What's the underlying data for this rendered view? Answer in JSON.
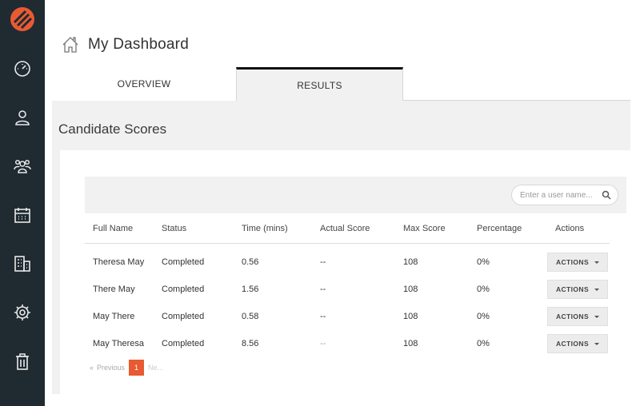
{
  "sidebar": {
    "logo": "brand-logo",
    "items": [
      {
        "icon": "speedometer-icon"
      },
      {
        "icon": "user-icon"
      },
      {
        "icon": "users-icon"
      },
      {
        "icon": "calendar-icon"
      },
      {
        "icon": "building-icon"
      },
      {
        "icon": "gear-icon"
      },
      {
        "icon": "trash-icon"
      }
    ]
  },
  "header": {
    "title": "My Dashboard",
    "icon": "home-icon"
  },
  "tabs": [
    {
      "label": "OVERVIEW",
      "active": false
    },
    {
      "label": "RESULTS",
      "active": true
    }
  ],
  "section": {
    "title": "Candidate Scores"
  },
  "search": {
    "placeholder": "Enter a user name..."
  },
  "table": {
    "columns": [
      "Full Name",
      "Status",
      "Time (mins)",
      "Actual Score",
      "Max Score",
      "Percentage",
      "Actions"
    ],
    "rows": [
      {
        "name": "Theresa May",
        "status": "Completed",
        "time": "0.56",
        "actual": "--",
        "max": "108",
        "pct": "0%",
        "action": "ACTIONS"
      },
      {
        "name": "There May",
        "status": "Completed",
        "time": "1.56",
        "actual": "--",
        "max": "108",
        "pct": "0%",
        "action": "ACTIONS"
      },
      {
        "name": "May There",
        "status": "Completed",
        "time": "0.58",
        "actual": "--",
        "max": "108",
        "pct": "0%",
        "action": "ACTIONS"
      },
      {
        "name": "May Theresa",
        "status": "Completed",
        "time": "8.56",
        "actual": "--",
        "max": "108",
        "pct": "0%",
        "action": "ACTIONS"
      }
    ]
  },
  "pagination": {
    "prev": "Previous",
    "current": "1",
    "next": "Ne..."
  },
  "colors": {
    "sidebar": "#1f2a31",
    "accent": "#e85a32",
    "content_bg": "#f2f1f2"
  }
}
